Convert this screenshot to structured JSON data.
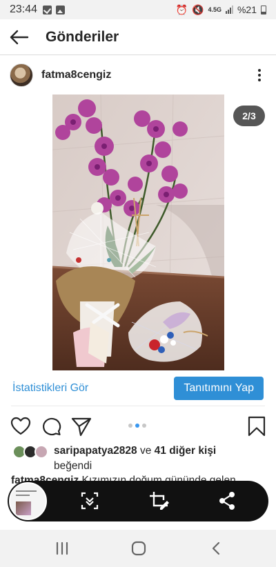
{
  "status_bar": {
    "time": "23:44",
    "network": "4.5G",
    "battery": "%21"
  },
  "header": {
    "title": "Gönderiler"
  },
  "post": {
    "username": "fatma8cengiz",
    "image_counter": "2/3",
    "carousel": {
      "current": 2,
      "total": 3
    }
  },
  "cta": {
    "insights_label": "İstatistikleri Gör",
    "promote_label": "Tanıtımını Yap"
  },
  "likes": {
    "liker": "saripapatya2828",
    "connector": "ve",
    "others": "41 diğer kişi",
    "suffix": "beğendi"
  },
  "caption": {
    "username": "fatma8cengiz",
    "text": "Kızımızın doğum gününde gelen"
  },
  "icons": {
    "back": "arrow-left-icon",
    "more": "more-vertical-icon",
    "like": "heart-icon",
    "comment": "comment-icon",
    "share": "paper-plane-icon",
    "save": "bookmark-icon",
    "scroll_capture": "scroll-capture-icon",
    "crop_edit": "crop-edit-icon",
    "share_screenshot": "share-icon",
    "nav_recents": "recents-icon",
    "nav_home": "home-icon",
    "nav_back": "chevron-left-icon"
  },
  "colors": {
    "accent": "#2f8fd6",
    "orchid": "#b0449c",
    "overlay_bar": "#111111"
  }
}
